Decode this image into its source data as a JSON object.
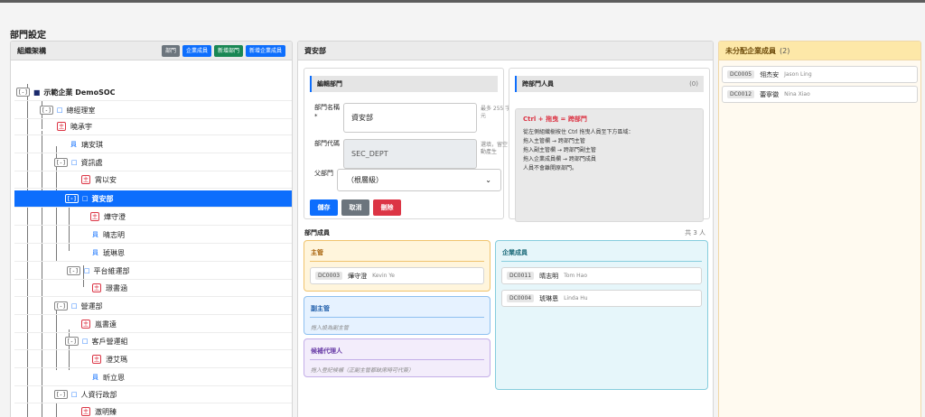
{
  "page": {
    "title": "部門設定"
  },
  "tree_panel": {
    "title": "組織架構",
    "buttons": [
      "部門",
      "企業成員",
      "新增部門",
      "新增企業成員"
    ],
    "nodes": [
      {
        "toggle": "[-]",
        "icon": "root-square-icon",
        "label": "示範企業 DemoSOC"
      },
      {
        "toggle": "[-]",
        "icon": "org-icon",
        "label": "總經理室"
      },
      {
        "badge": "主",
        "label": "曉承宇"
      },
      {
        "icon": "member-icon",
        "label": "璃安琪"
      },
      {
        "toggle": "[-]",
        "icon": "org-icon",
        "label": "資訊處"
      },
      {
        "badge": "主",
        "label": "霄以安"
      },
      {
        "toggle": "[-]",
        "icon": "org-icon",
        "label": "資安部",
        "selected": true
      },
      {
        "badge": "主",
        "label": "燁守澄"
      },
      {
        "icon": "member-icon",
        "label": "晴志明"
      },
      {
        "icon": "member-icon",
        "label": "琥琳恩"
      },
      {
        "toggle": "[-]",
        "icon": "org-icon",
        "label": "平台維運部"
      },
      {
        "badge": "主",
        "label": "璟書涵"
      },
      {
        "toggle": "[-]",
        "icon": "org-icon",
        "label": "營運部"
      },
      {
        "badge": "主",
        "label": "嵐書遠"
      },
      {
        "toggle": "[-]",
        "icon": "org-icon",
        "label": "客戶營運組"
      },
      {
        "badge": "主",
        "label": "澄艾瑪"
      },
      {
        "icon": "member-icon",
        "label": "昕立恩"
      },
      {
        "toggle": "[-]",
        "icon": "org-icon",
        "label": "人資行政部"
      },
      {
        "badge": "主",
        "label": "澈明臻"
      },
      {
        "icon": "org-icon",
        "label": "財務部"
      }
    ]
  },
  "mid_panel": {
    "title": "資安部",
    "edit": {
      "title": "編輯部門",
      "name_label": "部門名稱 *",
      "name_value": "資安部",
      "name_hint": "最多 255 字元",
      "code_label": "部門代碼",
      "code_value": "SEC_DEPT",
      "code_hint": "選填，留空自動產生",
      "parent_label": "父部門",
      "parent_value": "（根層級）",
      "save": "儲存",
      "cancel": "取消",
      "delete": "刪除"
    },
    "cross": {
      "title": "跨部門人員",
      "count": "(0)",
      "hint_title": "Ctrl + 拖曳 = 跨部門",
      "hint_lines": [
        "從左側組織樹按住 Ctrl 拖曳人員至下方區域：",
        "拖入主管欄 → 跨部門主管",
        "拖入副主管欄 → 跨部門副主管",
        "拖入企業成員欄 → 跨部門成員",
        "人員不會離開原部門。"
      ]
    },
    "members": {
      "title": "部門成員",
      "total": "共 3 人",
      "manager": {
        "title": "主管",
        "items": [
          {
            "code": "DC0003",
            "name": "燁守澄",
            "en": "Kevin Ye"
          }
        ]
      },
      "deputy": {
        "title": "副主管",
        "empty": "拖入設為副主管"
      },
      "candidate": {
        "title": "候補代理人",
        "empty": "拖入登記候補（正副主管都缺席時可代簽）"
      },
      "staff": {
        "title": "企業成員",
        "items": [
          {
            "code": "DC0011",
            "name": "晴志明",
            "en": "Tom Hao"
          },
          {
            "code": "DC0004",
            "name": "琥琳恩",
            "en": "Linda Hu"
          }
        ]
      }
    }
  },
  "right_panel": {
    "title": "未分配企業成員",
    "count": "(2)",
    "items": [
      {
        "code": "DC0005",
        "name": "翎杰安",
        "en": "Jason Ling"
      },
      {
        "code": "DC0012",
        "name": "蕾寧徽",
        "en": "Nina Xiao"
      }
    ]
  },
  "colors": {
    "primary": "#0d6efd",
    "danger": "#dc3545",
    "success": "#198754",
    "secondary": "#6c757d"
  }
}
